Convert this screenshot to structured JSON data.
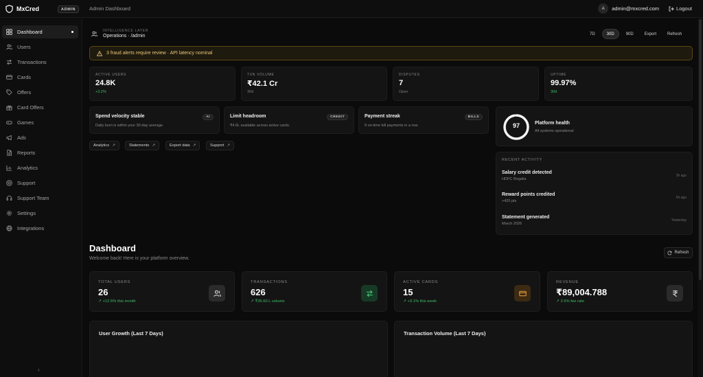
{
  "app": {
    "name": "MxCred",
    "badge": "ADMIN",
    "page_title": "Admin Dashboard"
  },
  "user": {
    "initial": "A",
    "email": "admin@mxcred.com",
    "logout_label": "Logout"
  },
  "sidebar": {
    "items": [
      {
        "label": "Dashboard",
        "icon": "grid-icon",
        "active": true
      },
      {
        "label": "Users",
        "icon": "users-icon"
      },
      {
        "label": "Transactions",
        "icon": "arrows-icon"
      },
      {
        "label": "Cards",
        "icon": "card-icon"
      },
      {
        "label": "Offers",
        "icon": "tag-icon"
      },
      {
        "label": "Card Offers",
        "icon": "gift-icon"
      },
      {
        "label": "Games",
        "icon": "gamepad-icon"
      },
      {
        "label": "Ads",
        "icon": "megaphone-icon"
      },
      {
        "label": "Reports",
        "icon": "file-icon"
      },
      {
        "label": "Analytics",
        "icon": "bar-chart-icon"
      },
      {
        "label": "Support",
        "icon": "lifebuoy-icon"
      },
      {
        "label": "Support Team",
        "icon": "headset-icon"
      },
      {
        "label": "Settings",
        "icon": "gear-icon"
      },
      {
        "label": "Integrations",
        "icon": "globe-icon"
      }
    ],
    "collapse_glyph": "‹"
  },
  "ops": {
    "label": "INTELLIGENCE LAYER",
    "path": "Operations · /admin"
  },
  "ranges": [
    {
      "label": "7D"
    },
    {
      "label": "30D",
      "active": true
    },
    {
      "label": "90D"
    },
    {
      "label": "Export"
    },
    {
      "label": "Refresh"
    }
  ],
  "alert": {
    "text": "3 fraud alerts require review · API latency nominal",
    "color": "#e7c97c"
  },
  "stats": [
    {
      "label": "ACTIVE USERS",
      "value": "24.8K",
      "sub": "+3.2%",
      "sub_tone": "green"
    },
    {
      "label": "TXN VOLUME",
      "value": "₹42.1 Cr",
      "sub": "30d",
      "sub_tone": "grey"
    },
    {
      "label": "DISPUTES",
      "value": "7",
      "sub": "Open",
      "sub_tone": "grey"
    },
    {
      "label": "UPTIME",
      "value": "99.97%",
      "sub": "30d",
      "sub_tone": "green"
    }
  ],
  "insights": [
    {
      "title": "Spend velocity stable",
      "desc": "Daily burn is within your 30-day average.",
      "tag": "AI"
    },
    {
      "title": "Limit headroom",
      "desc": "₹4.6L available across active cards.",
      "tag": "CREDIT"
    },
    {
      "title": "Payment streak",
      "desc": "9 on-time bill payments in a row.",
      "tag": "BILLS"
    }
  ],
  "quick_links": [
    {
      "label": "Analytics",
      "arrow": "↗"
    },
    {
      "label": "Statements",
      "arrow": "↗"
    },
    {
      "label": "Export data",
      "arrow": "↗"
    },
    {
      "label": "Support",
      "arrow": "↗"
    }
  ],
  "health": {
    "score": "97",
    "score_value": 97,
    "title": "Platform health",
    "sub": "All systems operational"
  },
  "activity": {
    "heading": "RECENT ACTIVITY",
    "items": [
      {
        "title": "Salary credit detected",
        "sub": "HDFC Regalia",
        "time": "2h ago"
      },
      {
        "title": "Reward points credited",
        "sub": "+420 pts",
        "time": "5h ago"
      },
      {
        "title": "Statement generated",
        "sub": "March 2026",
        "time": "Yesterday"
      }
    ]
  },
  "dashboard": {
    "title": "Dashboard",
    "subtitle": "Welcome back! Here is your platform overview.",
    "refresh_label": "Refresh"
  },
  "kpis": [
    {
      "label": "TOTAL USERS",
      "value": "26",
      "sub": "↗ +12.5% this month",
      "icon": "users-icon",
      "accent": "#2b2b2b"
    },
    {
      "label": "TRANSACTIONS",
      "value": "626",
      "sub": "↗ ₹35.60 L volume",
      "icon": "arrows-icon",
      "accent": "#173a26"
    },
    {
      "label": "ACTIVE CARDS",
      "value": "15",
      "sub": "↗ +3.1% this week",
      "icon": "card-icon",
      "accent": "#3d2a12"
    },
    {
      "label": "REVENUE",
      "value": "₹89,004.788",
      "sub": "↗ 2.5% fee rate",
      "icon": "rupee-icon",
      "accent": "#2b2b2b"
    }
  ],
  "charts": [
    {
      "title": "User Growth (Last 7 Days)"
    },
    {
      "title": "Transaction Volume (Last 7 Days)"
    }
  ]
}
